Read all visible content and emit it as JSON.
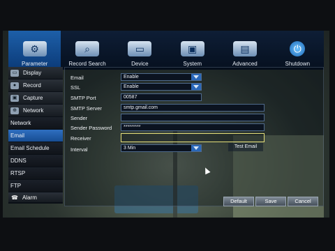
{
  "topbar": {
    "items": [
      {
        "label": "Parameter",
        "icon": "gears-icon",
        "active": true
      },
      {
        "label": "Record Search",
        "icon": "search-camera-icon",
        "active": false
      },
      {
        "label": "Device",
        "icon": "hdd-icon",
        "active": false
      },
      {
        "label": "System",
        "icon": "monitor-settings-icon",
        "active": false
      },
      {
        "label": "Advanced",
        "icon": "advanced-panel-icon",
        "active": false
      },
      {
        "label": "Shutdown",
        "icon": "power-icon",
        "active": false
      }
    ]
  },
  "sidebar": {
    "items": [
      {
        "label": "Display",
        "icon": "display-icon",
        "sub": false
      },
      {
        "label": "Record",
        "icon": "record-icon",
        "sub": false
      },
      {
        "label": "Capture",
        "icon": "capture-icon",
        "sub": false
      },
      {
        "label": "Network",
        "icon": "network-icon",
        "sub": false
      },
      {
        "label": "Network",
        "icon": "",
        "sub": true
      },
      {
        "label": "Email",
        "icon": "",
        "sub": true,
        "selected": true
      },
      {
        "label": "Email Schedule",
        "icon": "",
        "sub": true
      },
      {
        "label": "DDNS",
        "icon": "",
        "sub": true
      },
      {
        "label": "RTSP",
        "icon": "",
        "sub": true
      },
      {
        "label": "FTP",
        "icon": "",
        "sub": true
      }
    ],
    "alarm_label": "Alarm"
  },
  "form": {
    "email_label": "Email",
    "email_value": "Enable",
    "ssl_label": "SSL",
    "ssl_value": "Enable",
    "smtp_port_label": "SMTP Port",
    "smtp_port_value": "00587",
    "smtp_server_label": "SMTP Server",
    "smtp_server_value": "smtp.gmail.com",
    "sender_label": "Sender",
    "sender_value": "",
    "sender_password_label": "Sender Password",
    "sender_password_value": "*********",
    "receiver_label": "Receiver",
    "receiver_value": "",
    "interval_label": "Interval",
    "interval_value": "3 Min",
    "test_email_label": "Test Email"
  },
  "buttons": {
    "default_label": "Default",
    "save_label": "Save",
    "cancel_label": "Cancel"
  },
  "colors": {
    "accent": "#1d5fa8",
    "focus_border": "#e6e07a"
  }
}
